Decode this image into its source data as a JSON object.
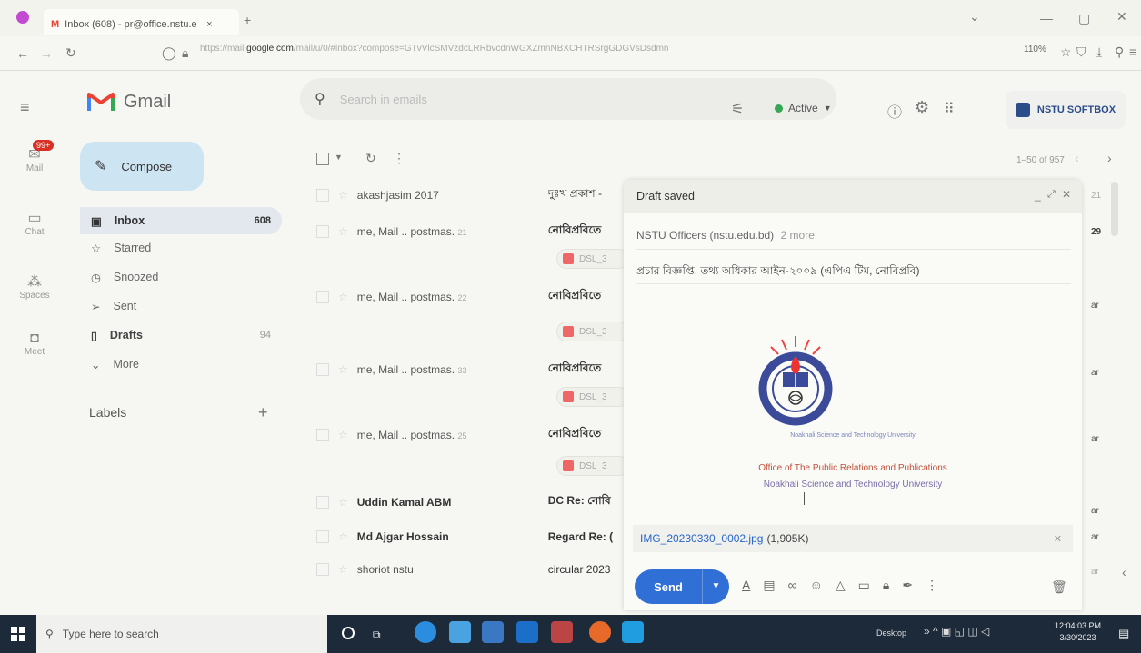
{
  "browser": {
    "tab_title": "Inbox (608) - pr@office.nstu.e",
    "tab_close": "×",
    "new_tab": "+",
    "url_prefix": "https://mail.",
    "url_domain": "google.com",
    "url_rest": "/mail/u/0/#inbox?compose=GTvVlcSMVzdcLRRbvcdnWGXZmnNBXCHTRSrgGDGVsDsdmn",
    "zoom": "110%"
  },
  "gmail": {
    "logo_text": "Gmail",
    "search_placeholder": "Search in emails",
    "status": "Active",
    "brand_badge": "NSTU SOFTBOX"
  },
  "rail": {
    "mail_badge": "99+",
    "items": [
      {
        "label": "Mail"
      },
      {
        "label": "Chat"
      },
      {
        "label": "Spaces"
      },
      {
        "label": "Meet"
      }
    ]
  },
  "sidebar": {
    "compose": "Compose",
    "items": [
      {
        "label": "Inbox",
        "count": "608"
      },
      {
        "label": "Starred",
        "count": ""
      },
      {
        "label": "Snoozed",
        "count": ""
      },
      {
        "label": "Sent",
        "count": ""
      },
      {
        "label": "Drafts",
        "count": "94"
      },
      {
        "label": "More",
        "count": ""
      }
    ],
    "labels_heading": "Labels",
    "labels_add": "+"
  },
  "list": {
    "pagination": "1–50 of 957",
    "rows": [
      {
        "from": "akashjasim 2017",
        "count": "",
        "subject": "দুঃখ প্রকাশ - ",
        "date": "21"
      },
      {
        "from": "me, Mail .. postmas.",
        "count": "21",
        "subject": "নোবিপ্রবিতে",
        "date": "29",
        "attachment": "DSL_3"
      },
      {
        "from": "me, Mail .. postmas.",
        "count": "22",
        "subject": "নোবিপ্রবিতে",
        "date": "ar",
        "attachment": "DSL_3"
      },
      {
        "from": "me, Mail .. postmas.",
        "count": "33",
        "subject": "নোবিপ্রবিতে",
        "date": "ar",
        "attachment": "DSL_3"
      },
      {
        "from": "me, Mail .. postmas.",
        "count": "25",
        "subject": "নোবিপ্রবিতে",
        "date": "ar",
        "attachment": "DSL_3"
      },
      {
        "from": "Uddin Kamal ABM",
        "count": "",
        "subject": "DC Re: নোবি",
        "date": "ar"
      },
      {
        "from": "Md Ajgar Hossain",
        "count": "",
        "subject": "Regard Re: (",
        "date": "ar"
      },
      {
        "from": "shoriot nstu",
        "count": "",
        "subject": "circular 2023",
        "date": "ar"
      }
    ]
  },
  "compose_window": {
    "header": "Draft saved",
    "recipients": "NSTU Officers (nstu.edu.bd)",
    "more_recipients": "2 more",
    "subject": "প্রচার বিজ্ঞপ্তি, তথ্য অধিকার আইন-২০০৯ (এপিএ টিম, নোবিপ্রবি)",
    "logo_ring_text": "Noakhali Science and Technology University",
    "office_line1": "Office of The Public Relations and Publications",
    "office_line2": "Noakhali Science and Technology University",
    "attachment_name": "IMG_20230330_0002.jpg",
    "attachment_size": "(1,905K)",
    "send": "Send"
  },
  "taskbar": {
    "search_placeholder": "Type here to search",
    "desktop_label": "Desktop",
    "time": "12:04:03 PM",
    "date": "3/30/2023"
  },
  "colors": {
    "compose_bg": "#cde5f3",
    "send_blue": "#2f6fd6",
    "gmail_red": "#ea4335",
    "active_green": "#34a853"
  }
}
